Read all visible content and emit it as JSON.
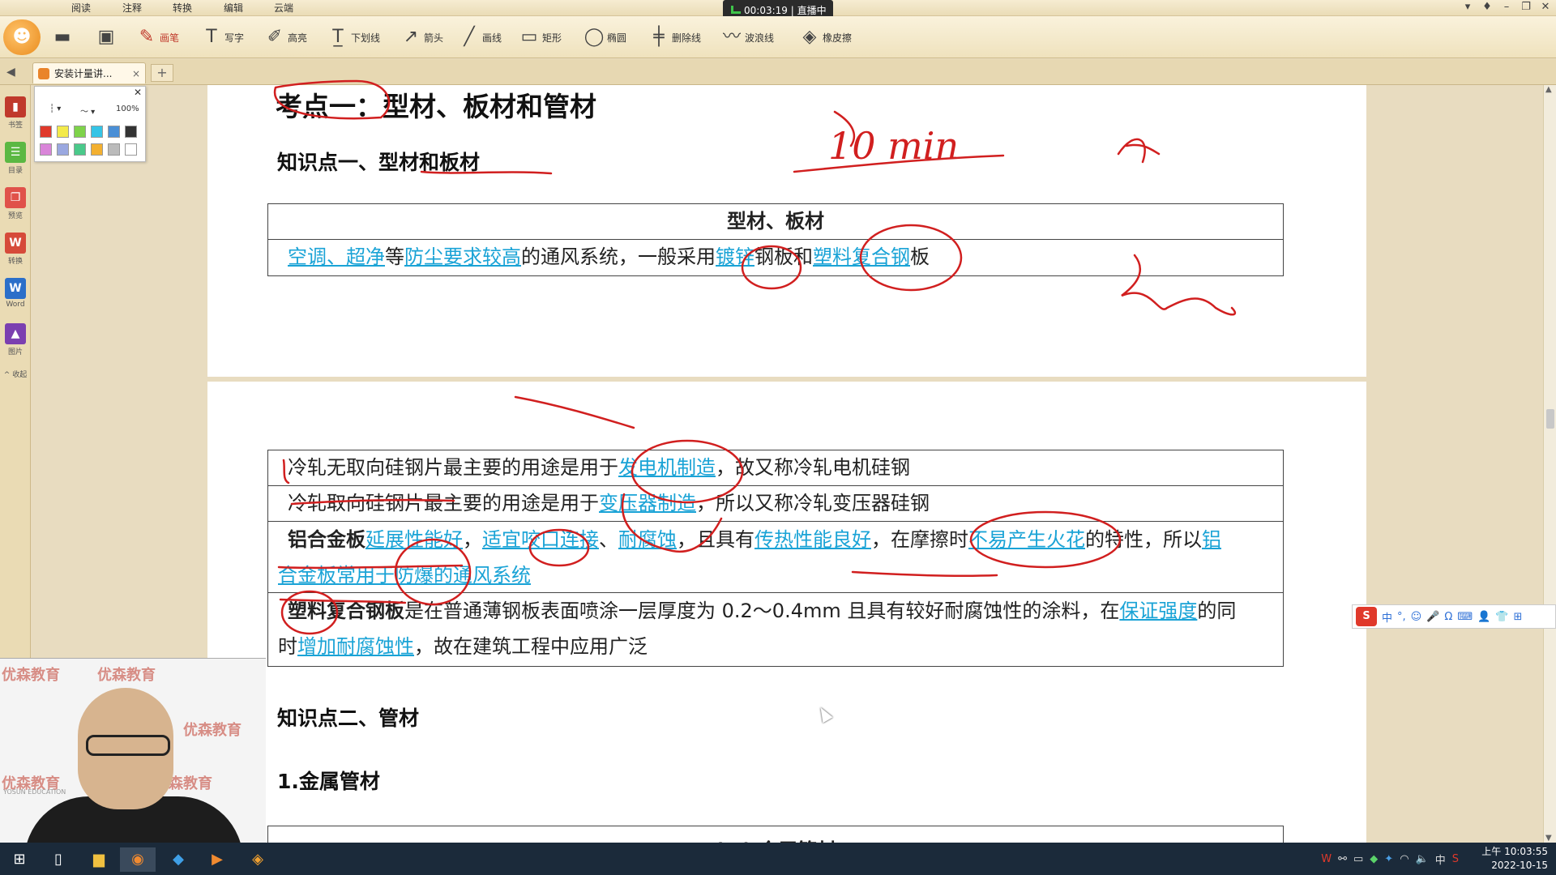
{
  "menu": {
    "tabs": [
      "阅读",
      "注释",
      "转换",
      "编辑",
      "云端"
    ]
  },
  "live": {
    "time": "00:03:19",
    "status": "直播中"
  },
  "toolbar": {
    "buttons": [
      {
        "label": "",
        "icon": "folder-icon"
      },
      {
        "label": "",
        "icon": "save-icon"
      },
      {
        "label": "画笔",
        "icon": "pen-icon"
      },
      {
        "label": "写字",
        "icon": "text-tool-icon"
      },
      {
        "label": "高亮",
        "icon": "highlight-icon"
      },
      {
        "label": "下划线",
        "icon": "underline-icon"
      },
      {
        "label": "箭头",
        "icon": "arrow-icon"
      },
      {
        "label": "画线",
        "icon": "line-icon"
      },
      {
        "label": "矩形",
        "icon": "rectangle-icon"
      },
      {
        "label": "椭圆",
        "icon": "ellipse-icon"
      },
      {
        "label": "删除线",
        "icon": "strikethrough-icon"
      },
      {
        "label": "波浪线",
        "icon": "wave-icon"
      },
      {
        "label": "橡皮擦",
        "icon": "eraser-icon"
      }
    ]
  },
  "tabbar": {
    "doc_tab": "安装计量讲...",
    "new_tab": "+"
  },
  "sidebar": {
    "items": [
      {
        "label": "书签",
        "color": "#c0392b",
        "glyph": "▮"
      },
      {
        "label": "目录",
        "color": "#5bb843",
        "glyph": "☰"
      },
      {
        "label": "预览",
        "color": "#e0524a",
        "glyph": "❐"
      },
      {
        "label": "转换",
        "color": "#d64a3a",
        "glyph": "W"
      },
      {
        "label": "Word",
        "color": "#2b6fc9",
        "glyph": "W"
      },
      {
        "label": "图片",
        "color": "#7b3fb0",
        "glyph": "▲"
      }
    ],
    "collapse": "^ 收起"
  },
  "palette": {
    "zoom": "100%",
    "row1": [
      "#e0392b",
      "#f3ea4a",
      "#7ed34a",
      "#35c4e6",
      "#4a8fd6",
      "#333333"
    ],
    "row2": [
      "#d985d9",
      "#9aa8e0",
      "#4ac98a",
      "#f3b030",
      "#bbbbbb",
      "#ffffff"
    ]
  },
  "doc": {
    "heading1": "考点一：型材、板材和管材",
    "section1": "知识点一、型材和板材",
    "table1": {
      "header": "型材、板材",
      "row": [
        {
          "t": "空调、超净",
          "hl": true
        },
        {
          "t": "等",
          "hl": false
        },
        {
          "t": "防尘要求较高",
          "hl": true
        },
        {
          "t": "的通风系统，一般采用",
          "hl": false
        },
        {
          "t": "镀锌",
          "hl": true
        },
        {
          "t": "钢板和",
          "hl": false
        },
        {
          "t": "塑料复合钢",
          "hl": true
        },
        {
          "t": "板",
          "hl": false
        }
      ]
    },
    "table2": {
      "r1": [
        {
          "t": "冷轧无取向硅钢片最主要的用途是用于",
          "hl": false
        },
        {
          "t": "发电机制造",
          "hl": true
        },
        {
          "t": "，故又称冷轧电机硅钢",
          "hl": false
        }
      ],
      "r2": [
        {
          "t": "冷轧取向硅钢片最主要的用途是用于",
          "hl": false
        },
        {
          "t": "变压器制造",
          "hl": true
        },
        {
          "t": "，所以又称冷轧变压器硅钢",
          "hl": false
        }
      ],
      "r3a": [
        {
          "t": "铝合金板",
          "hl": false,
          "b": true
        },
        {
          "t": "延展性能好",
          "hl": true
        },
        {
          "t": "，",
          "hl": false
        },
        {
          "t": "适宜咬口连接",
          "hl": true
        },
        {
          "t": "、",
          "hl": false
        },
        {
          "t": "耐腐蚀",
          "hl": true
        },
        {
          "t": "，且具有",
          "hl": false
        },
        {
          "t": "传热性能良好",
          "hl": true
        },
        {
          "t": "，在摩擦时",
          "hl": false
        },
        {
          "t": "不易产生火花",
          "hl": true
        },
        {
          "t": "的特性，所以",
          "hl": false
        },
        {
          "t": "铝",
          "hl": true
        }
      ],
      "r3b": [
        {
          "t": "合金板常用于防爆的通风系统",
          "hl": true
        }
      ],
      "r4a": [
        {
          "t": "塑料复合钢板",
          "hl": false,
          "b": true
        },
        {
          "t": "是在普通薄钢板表面喷涂一层厚度为 0.2～0.4mm 且具有较好耐腐蚀性的涂料，在",
          "hl": false
        },
        {
          "t": "保证强度",
          "hl": true
        },
        {
          "t": "的同",
          "hl": false
        }
      ],
      "r4b": [
        {
          "t": "时",
          "hl": false
        },
        {
          "t": "增加耐腐蚀性",
          "hl": true
        },
        {
          "t": "，故在建筑工程中应用广泛",
          "hl": false
        }
      ]
    },
    "section2": "知识点二、管材",
    "subsection": "1.金属管材",
    "table3_header": "(一) 金属管材"
  },
  "handwriting": {
    "note1": "10 min"
  },
  "webcam": {
    "watermark": "优森教育",
    "watermark_en": "YOSUN EDUCATION"
  },
  "ime": {
    "items": [
      "中",
      "°,",
      "☺",
      "🎤",
      "Ω",
      "⌨",
      "👤",
      "👕",
      "⊞"
    ]
  },
  "taskbar": {
    "apps": [
      "start-icon",
      "task-view-icon",
      "file-explorer-icon",
      "pdf-app-icon",
      "feishu-icon",
      "media-icon",
      "net-icon"
    ],
    "tray_lang": "中",
    "time": "上午 10:03:55",
    "date": "2022-10-15"
  }
}
